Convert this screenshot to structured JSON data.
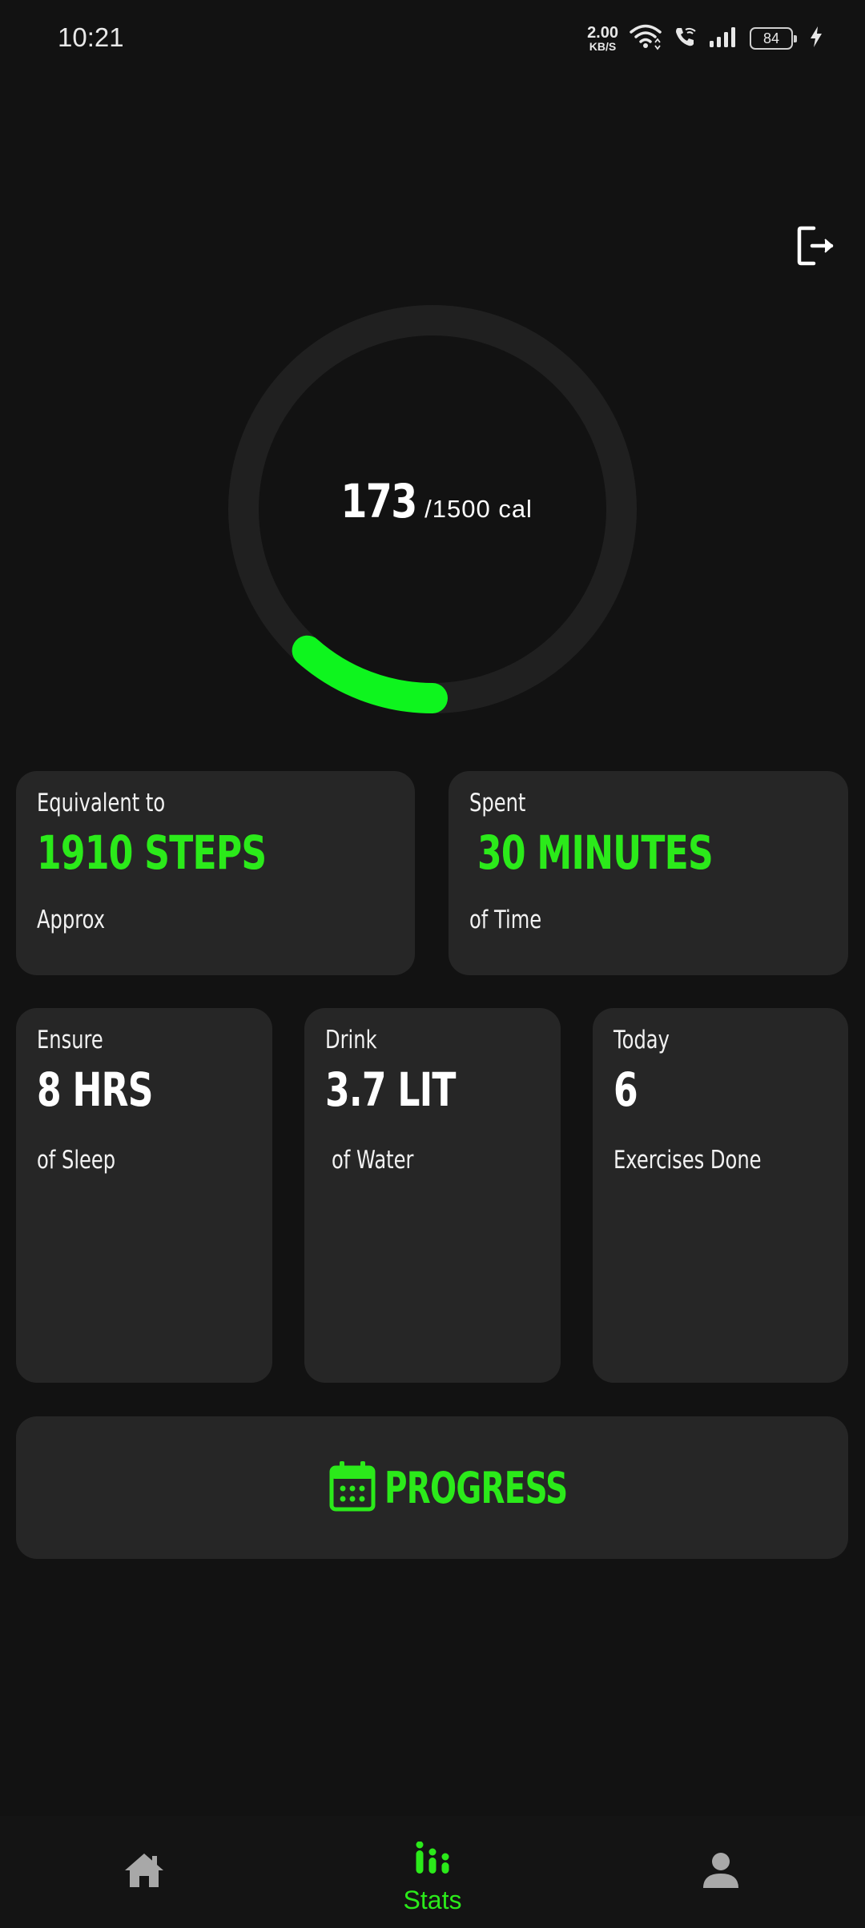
{
  "status_bar": {
    "time": "10:21",
    "net_speed_value": "2.00",
    "net_speed_unit": "KB/S",
    "battery_level": "84"
  },
  "calories": {
    "value": "173",
    "goal_text": "/1500 cal",
    "progress_fraction": 0.1153
  },
  "cards": {
    "steps": {
      "label": "Equivalent to",
      "value": "1910 STEPS",
      "sub": "Approx"
    },
    "time": {
      "label": "Spent",
      "value": "30 MINUTES",
      "sub": "of Time"
    },
    "sleep": {
      "label": "Ensure",
      "value": "8 HRS",
      "sub": "of Sleep"
    },
    "water": {
      "label": "Drink",
      "value": "3.7 LIT",
      "sub": "of Water"
    },
    "exercise": {
      "label": "Today",
      "value": "6",
      "sub": "Exercises Done"
    }
  },
  "progress_button": {
    "label": "PROGRESS"
  },
  "bottom_nav": {
    "items": [
      {
        "icon": "home-icon",
        "label": ""
      },
      {
        "icon": "stats-icon",
        "label": "Stats",
        "active": true
      },
      {
        "icon": "profile-icon",
        "label": ""
      }
    ]
  },
  "colors": {
    "accent": "#2bea1a",
    "ring_progress": "#0ef51e",
    "background": "#121212",
    "card": "#262626",
    "ring_track": "#202020",
    "inactive_icon": "#a8a8a8"
  }
}
